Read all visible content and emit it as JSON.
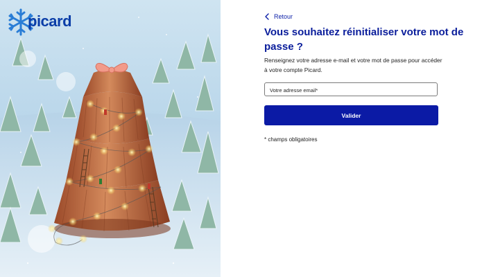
{
  "brand": {
    "name": "picard",
    "color": "#0b3ea8",
    "logo_icon": "snowflake-icon"
  },
  "hero": {
    "subject": "christmas-tree-cake-illustration"
  },
  "form": {
    "back_label": "Retour",
    "back_icon": "chevron-left-icon",
    "title": "Vous souhaitez réinitialiser votre mot de passe ?",
    "description": "Renseignez votre adresse e-mail et votre mot de passe pour accéder à votre compte Picard.",
    "email_placeholder": "Votre adresse email*",
    "email_value": "",
    "submit_label": "Valider",
    "required_note": "* champs obligatoires"
  },
  "colors": {
    "accent": "#0b1aa5",
    "title": "#0a1d9b",
    "text": "#222222"
  }
}
